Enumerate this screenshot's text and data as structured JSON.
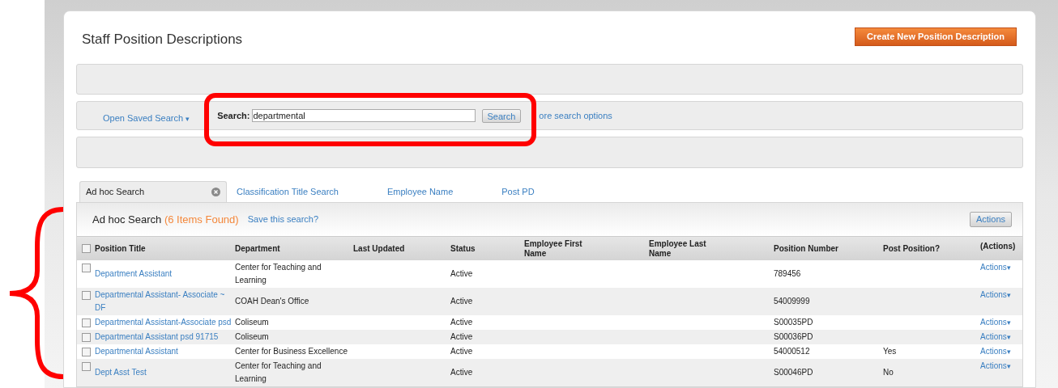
{
  "page": {
    "title": "Staff Position Descriptions",
    "create_button": "Create New Position Description"
  },
  "saved_search": {
    "label": "Open Saved Search",
    "caret": "▾"
  },
  "search": {
    "label": "Search:",
    "value": "departmental",
    "button": "Search",
    "more_link": "ore search options"
  },
  "tabs": [
    {
      "label": "Ad hoc Search",
      "selected": true,
      "closable": true
    },
    {
      "label": "Classification Title Search",
      "selected": false,
      "closable": false
    },
    {
      "label": "Employee Name",
      "selected": false,
      "closable": false
    },
    {
      "label": "Post PD",
      "selected": false,
      "closable": false
    }
  ],
  "results": {
    "title": "Ad hoc Search",
    "count": "(6 Items Found)",
    "save_link": "Save this search?",
    "actions_button": "Actions"
  },
  "table": {
    "select_all_checked": false,
    "columns": [
      "Position Title",
      "Department",
      "Last Updated",
      "Status",
      "Employee First Name",
      "Employee Last Name",
      "Position Number",
      "Post Position?",
      "(Actions)"
    ],
    "rows": [
      {
        "checked": false,
        "cells": [
          "Department Assistant",
          "Center for Teaching and Learning",
          null,
          "Active",
          null,
          null,
          "789456",
          null
        ],
        "actions": "Actions",
        "caret": "▾"
      },
      {
        "checked": false,
        "cells": [
          "Departmental Assistant- Associate ~ DF",
          "COAH Dean's Office",
          null,
          "Active",
          null,
          null,
          "54009999",
          null
        ],
        "actions": "Actions",
        "caret": "▾"
      },
      {
        "checked": false,
        "cells": [
          "Departmental Assistant-Associate psd",
          "Coliseum",
          null,
          "Active",
          null,
          null,
          "S00035PD",
          null
        ],
        "actions": "Actions",
        "caret": "▾"
      },
      {
        "checked": false,
        "cells": [
          "Departmental Assistant psd 91715",
          "Coliseum",
          null,
          "Active",
          null,
          null,
          "S00036PD",
          null
        ],
        "actions": "Actions",
        "caret": "▾"
      },
      {
        "checked": false,
        "cells": [
          "Departmental Assistant",
          "Center for Business Excellence",
          null,
          "Active",
          null,
          null,
          "54000512",
          "Yes"
        ],
        "actions": "Actions",
        "caret": "▾"
      },
      {
        "checked": false,
        "cells": [
          "Dept Asst Test",
          "Center for Teaching and Learning",
          null,
          "Active",
          null,
          null,
          "S00046PD",
          "No"
        ],
        "actions": "Actions",
        "caret": "▾"
      }
    ]
  }
}
